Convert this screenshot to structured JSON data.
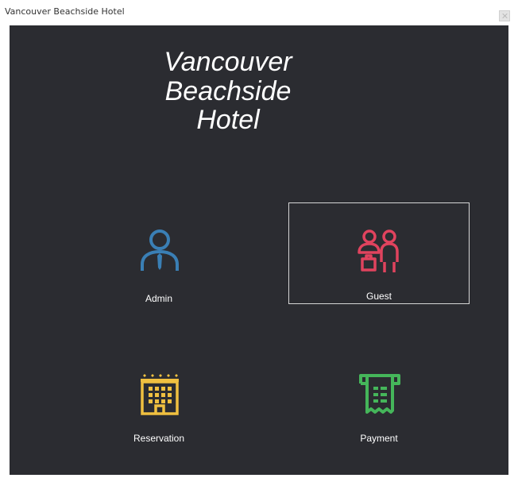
{
  "window": {
    "title": "Vancouver Beachside Hotel"
  },
  "header": {
    "line1": "Vancouver",
    "line2": "Beachside",
    "line3": "Hotel"
  },
  "tiles": [
    {
      "label": "Admin",
      "icon": "admin-user-icon",
      "color": "#3a7fb5"
    },
    {
      "label": "Guest",
      "icon": "guest-icon",
      "color": "#e0435e",
      "selected": true
    },
    {
      "label": "Reservation",
      "icon": "hotel-building-icon",
      "color": "#f0c040"
    },
    {
      "label": "Payment",
      "icon": "receipt-icon",
      "color": "#45b65a"
    }
  ]
}
